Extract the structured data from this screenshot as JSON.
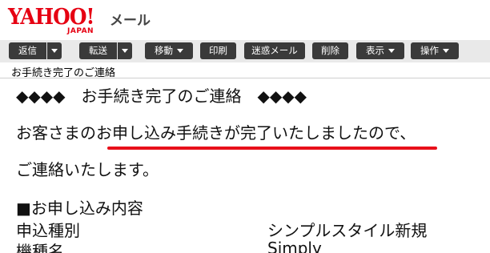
{
  "header": {
    "logo_word": "YAHOO!",
    "logo_sub": "JAPAN",
    "service_name": "メール"
  },
  "toolbar": {
    "reply": "返信",
    "forward": "転送",
    "move": "移動",
    "print": "印刷",
    "spam": "迷惑メール",
    "delete": "削除",
    "view": "表示",
    "actions": "操作"
  },
  "message": {
    "subject": "お手続き完了のご連絡",
    "title_line": "◆◆◆◆　お手続き完了のご連絡　◆◆◆◆",
    "paragraph_line1": "お客さまのお申し込み手続きが完了いたしましたので、",
    "paragraph_line2": "ご連絡いたします。",
    "section_heading": "■お申し込み内容",
    "details": [
      {
        "label": "申込種別",
        "value": "シンプルスタイル新規"
      },
      {
        "label": "機種名",
        "value": "Simply"
      }
    ]
  },
  "colors": {
    "brand_red": "#e60012",
    "toolbar_button": "#3a3a3a",
    "highlight_underline": "#e8101a"
  }
}
